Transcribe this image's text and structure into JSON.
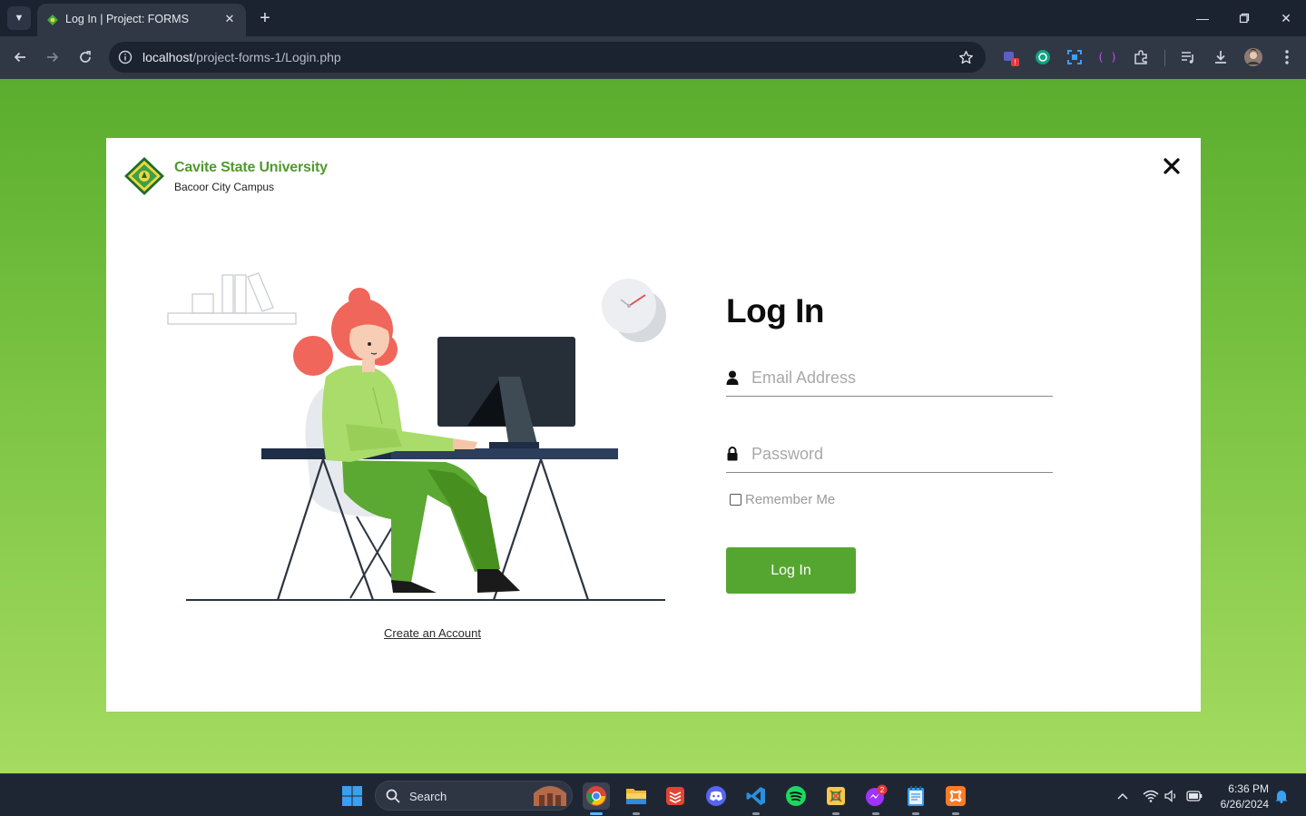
{
  "browser": {
    "tab_title": "Log In | Project: FORMS",
    "url_host": "localhost",
    "url_path": "/project-forms-1/Login.php"
  },
  "page": {
    "brand_name": "Cavite State University",
    "brand_subtitle": "Bacoor City Campus",
    "login_title": "Log In",
    "email_placeholder": "Email Address",
    "password_placeholder": "Password",
    "remember_label": "Remember Me",
    "login_button": "Log In",
    "create_account_link": "Create an Account",
    "accent_color": "#55a630"
  },
  "taskbar": {
    "search_label": "Search",
    "time": "6:36 PM",
    "date": "6/26/2024",
    "messenger_badge": "2"
  }
}
